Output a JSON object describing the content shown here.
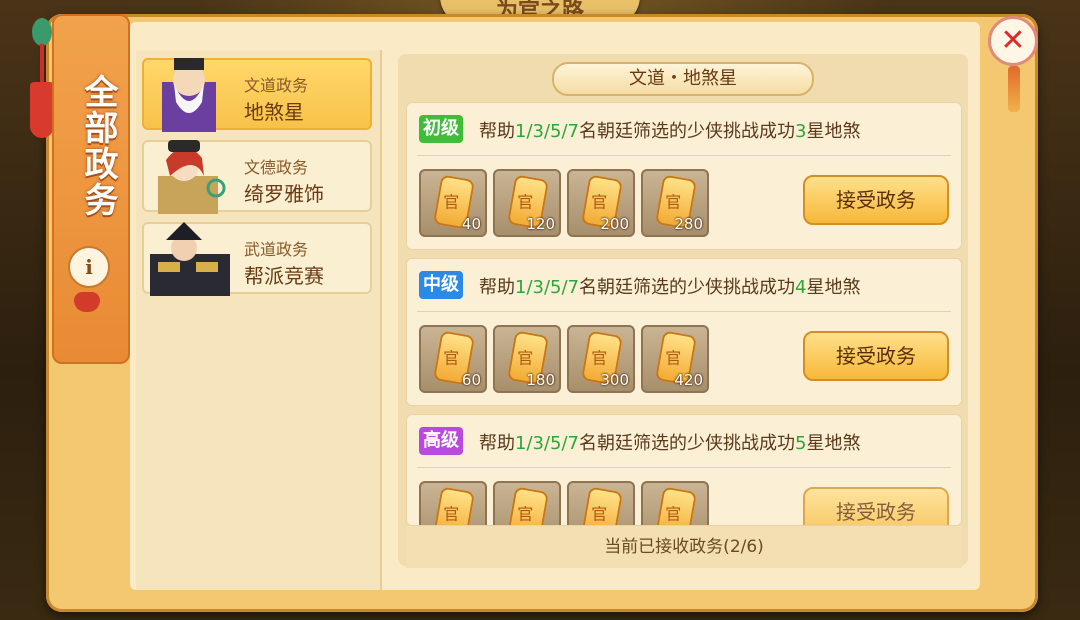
{
  "top_title": "为官之路",
  "sidebar": {
    "title": "全部政务"
  },
  "npcs": [
    {
      "type": "文道政务",
      "name": "地煞星",
      "selected": true
    },
    {
      "type": "文德政务",
      "name": "绮罗雅饰",
      "selected": false
    },
    {
      "type": "武道政务",
      "name": "帮派竞赛",
      "selected": false
    }
  ],
  "detail": {
    "header": "文道・地煞星",
    "tasks": [
      {
        "tier": "初级",
        "desc_prefix": "帮助",
        "desc_counts": "1/3/5/7",
        "desc_mid": "名朝廷筛选的少侠挑战成功",
        "desc_star": "3",
        "desc_suffix": "星地煞",
        "rewards": [
          "40",
          "120",
          "200",
          "280"
        ],
        "button": "接受政务"
      },
      {
        "tier": "中级",
        "desc_prefix": "帮助",
        "desc_counts": "1/3/5/7",
        "desc_mid": "名朝廷筛选的少侠挑战成功",
        "desc_star": "4",
        "desc_suffix": "星地煞",
        "rewards": [
          "60",
          "180",
          "300",
          "420"
        ],
        "button": "接受政务"
      },
      {
        "tier": "高级",
        "desc_prefix": "帮助",
        "desc_counts": "1/3/5/7",
        "desc_mid": "名朝廷筛选的少侠挑战成功",
        "desc_star": "5",
        "desc_suffix": "星地煞",
        "rewards": [
          "",
          "",
          "",
          ""
        ],
        "button": "接受政务"
      }
    ],
    "status": "当前已接收政务(2/6)"
  },
  "icons": {
    "close": "close-icon",
    "info": "info-icon",
    "reward": "official-scroll-icon"
  },
  "colors": {
    "tier1": "#3fbd3a",
    "tier2": "#2a8ae6",
    "tier3": "#b84ae0",
    "highlight": "#2ea63a",
    "accent": "#f6b83a"
  }
}
